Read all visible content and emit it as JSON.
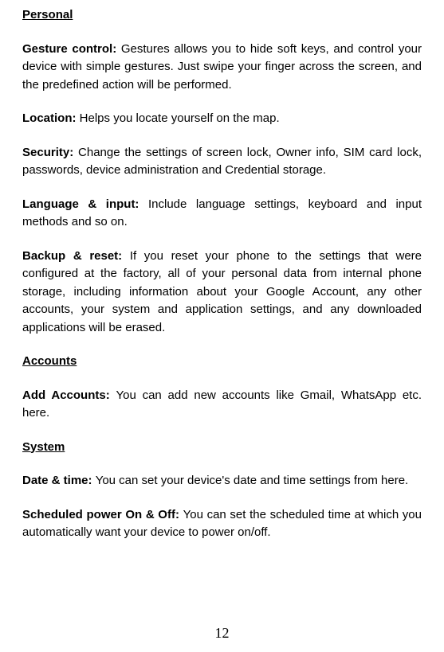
{
  "sections": {
    "personal": {
      "header": "Personal",
      "entries": {
        "gesture_control": {
          "label": "Gesture control: ",
          "text": "Gestures allows you to hide soft keys, and control your device with simple gestures. Just swipe your finger across the screen, and the predefined action will be performed."
        },
        "location": {
          "label": "Location: ",
          "text": "Helps you locate yourself on the map."
        },
        "security": {
          "label": "Security: ",
          "text": "Change the settings of screen lock, Owner info, SIM card lock, passwords, device administration and Credential storage."
        },
        "language_input": {
          "label": "Language & input: ",
          "text": "Include language settings, keyboard and input methods and so on."
        },
        "backup_reset": {
          "label": "Backup & reset: ",
          "text": "If you reset your phone to the settings that were configured at the factory, all of your personal data from internal phone storage, including information about your Google Account, any other accounts, your system and application settings, and any downloaded applications will be erased."
        }
      }
    },
    "accounts": {
      "header": "Accounts",
      "entries": {
        "add_accounts": {
          "label": "Add Accounts: ",
          "text": "You can add new accounts like Gmail, WhatsApp etc. here."
        }
      }
    },
    "system": {
      "header": "System",
      "entries": {
        "date_time": {
          "label": "Date & time: ",
          "text": "You can set your device's date and time settings from here."
        },
        "scheduled_power": {
          "label": "Scheduled power On & Off: ",
          "text": "You can set the scheduled time at which you automatically want your device to power on/off."
        }
      }
    }
  },
  "page_number": "12"
}
